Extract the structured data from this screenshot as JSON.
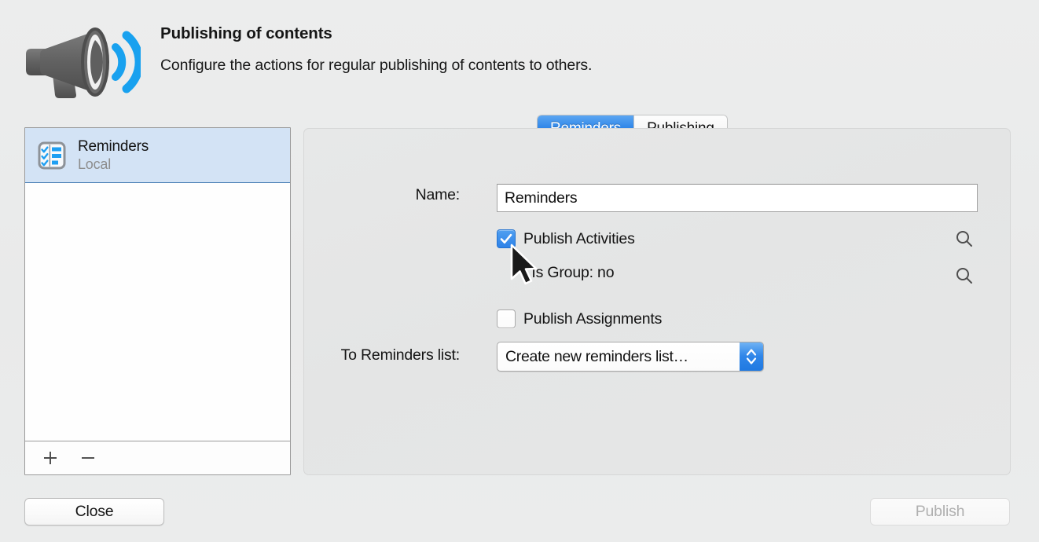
{
  "header": {
    "icon": "megaphone-icon",
    "title": "Publishing of contents",
    "subtitle": "Configure the actions for regular publishing of contents to others."
  },
  "sidebar": {
    "items": [
      {
        "icon": "reminders-checklist-icon",
        "title": "Reminders",
        "subtitle": "Local",
        "selected": true
      }
    ],
    "toolbar": {
      "add_label": "+",
      "remove_label": "−",
      "add_icon": "plus-icon",
      "remove_icon": "minus-icon"
    }
  },
  "tabs": [
    {
      "label": "Reminders",
      "selected": true
    },
    {
      "label": "Publishing",
      "selected": false
    }
  ],
  "form": {
    "name_label": "Name:",
    "name_value": "Reminders",
    "name_placeholder": "",
    "publish_activities_label": "Publish Activities",
    "publish_activities_checked": true,
    "is_group_label": ": Is Group: no",
    "publish_assignments_label": "Publish Assignments",
    "publish_assignments_checked": false,
    "to_list_label": "To Reminders list:",
    "to_list_value": "Create new reminders list…",
    "search_icon": "search-icon"
  },
  "footer": {
    "close_label": "Close",
    "publish_label": "Publish",
    "publish_disabled": true
  },
  "colors": {
    "accent_blue": "#2d82e8",
    "tab_selected_blue": "#2e85e8",
    "selection_row": "#d3e3f5",
    "window_bg": "#ebecec",
    "panel_bg": "#e6e7e7",
    "disabled_text": "#b0b0b0"
  }
}
